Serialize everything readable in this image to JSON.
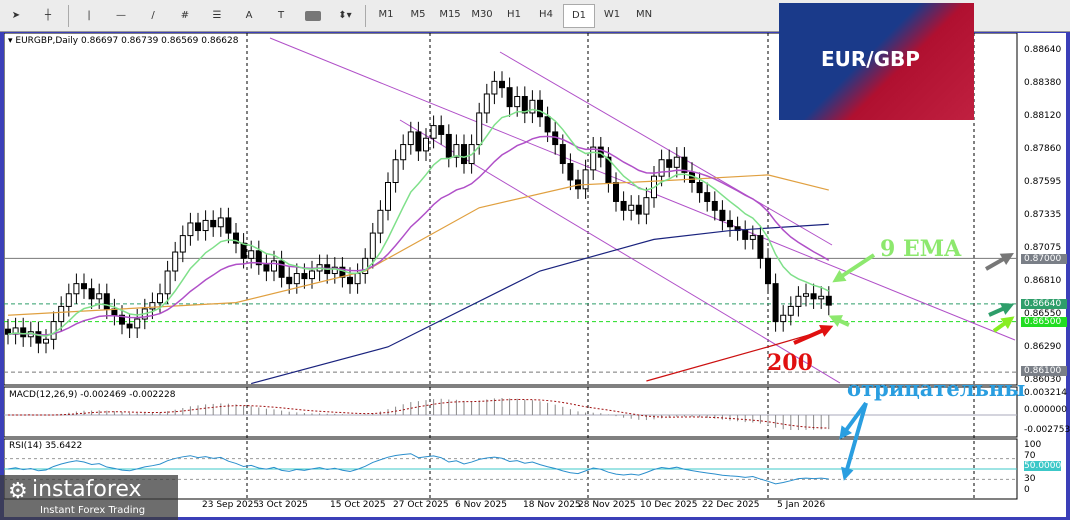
{
  "toolbar": {
    "tools": [
      "cursor",
      "crosshair",
      "vertical-line",
      "horizontal-line",
      "trendline",
      "fibonacci-expansion",
      "fibonacci-fan",
      "text",
      "text-label",
      "rectangle",
      "arrows"
    ],
    "text_tool": "A",
    "timeframes": [
      "M1",
      "M5",
      "M15",
      "M30",
      "H1",
      "H4",
      "D1",
      "W1",
      "MN"
    ],
    "active": "D1"
  },
  "header": {
    "symbol": "EURGBP,Daily",
    "ohlc": "0.86697 0.86739 0.86569 0.86628"
  },
  "banner": {
    "text": "EUR/GBP"
  },
  "annotations": {
    "ema": "9 EMA",
    "ma200": "200",
    "macd_note": "отрицательны"
  },
  "price_axis": [
    "0.88640",
    "0.88380",
    "0.88120",
    "0.87860",
    "0.87595",
    "0.87335",
    "0.87075",
    "0.86810",
    "0.86550",
    "0.86290",
    "0.86030"
  ],
  "price_tags": [
    {
      "text": "0.87000",
      "color": "#7a7f87"
    },
    {
      "text": "0.86640",
      "color": "#2e9e6a"
    },
    {
      "text": "0.86500",
      "color": "#22dd22"
    },
    {
      "text": "0.86100",
      "color": "#7a7f87"
    }
  ],
  "macd": {
    "label": "MACD(12,26,9) -0.002469 -0.002228",
    "axis": [
      "0.003214",
      "0.000000",
      "-0.002753"
    ]
  },
  "rsi": {
    "label": "RSI(14) 35.6422",
    "axis": [
      "100",
      "70",
      "50.0000",
      "30",
      "0"
    ]
  },
  "dates": [
    "23 Sep 2025",
    "3 Oct 2025",
    "15 Oct 2025",
    "27 Oct 2025",
    "6 Nov 2025",
    "18 Nov 2025",
    "28 Nov 2025",
    "10 Dec 2025",
    "22 Dec 2025",
    "5 Jan 2026"
  ],
  "logo": {
    "name": "instaforex",
    "tagline": "Instant Forex Trading"
  },
  "chart_data": {
    "type": "candlestick",
    "title": "EURGBP, Daily",
    "ylim": [
      0.8603,
      0.8864
    ],
    "closes": [
      0.864,
      0.8645,
      0.8638,
      0.8642,
      0.8633,
      0.8636,
      0.865,
      0.8662,
      0.8672,
      0.868,
      0.8676,
      0.8668,
      0.8672,
      0.866,
      0.8655,
      0.8648,
      0.8645,
      0.8652,
      0.866,
      0.8665,
      0.8672,
      0.869,
      0.8705,
      0.8718,
      0.8728,
      0.8722,
      0.873,
      0.8725,
      0.8732,
      0.872,
      0.8712,
      0.87,
      0.8706,
      0.8695,
      0.869,
      0.8698,
      0.8685,
      0.868,
      0.8688,
      0.8684,
      0.869,
      0.8695,
      0.8688,
      0.8693,
      0.8685,
      0.868,
      0.8688,
      0.87,
      0.872,
      0.8738,
      0.876,
      0.8778,
      0.879,
      0.88,
      0.8785,
      0.8795,
      0.8805,
      0.8798,
      0.878,
      0.879,
      0.8775,
      0.879,
      0.8815,
      0.883,
      0.884,
      0.8835,
      0.882,
      0.8828,
      0.8815,
      0.8825,
      0.8812,
      0.88,
      0.879,
      0.8775,
      0.8762,
      0.8755,
      0.877,
      0.8788,
      0.878,
      0.876,
      0.8745,
      0.8738,
      0.8742,
      0.8735,
      0.8748,
      0.8765,
      0.8778,
      0.8772,
      0.878,
      0.8768,
      0.876,
      0.8752,
      0.8745,
      0.8738,
      0.873,
      0.8725,
      0.8722,
      0.8715,
      0.8718,
      0.87,
      0.868,
      0.865,
      0.8655,
      0.8662,
      0.867,
      0.8672,
      0.8668,
      0.867,
      0.8663
    ],
    "ma50": [
      [
        0,
        0.8655
      ],
      [
        30,
        0.8665
      ],
      [
        47,
        0.869
      ],
      [
        62,
        0.874
      ],
      [
        75,
        0.8758
      ],
      [
        88,
        0.8762
      ],
      [
        100,
        0.8766
      ],
      [
        108,
        0.8754
      ]
    ],
    "ma100": [
      [
        32,
        0.8601
      ],
      [
        50,
        0.863
      ],
      [
        70,
        0.869
      ],
      [
        85,
        0.8715
      ],
      [
        95,
        0.8722
      ],
      [
        108,
        0.8727
      ]
    ],
    "ma200": [
      [
        84,
        0.8603
      ],
      [
        100,
        0.863
      ],
      [
        108,
        0.8644
      ]
    ],
    "levels": [
      0.87,
      0.8664,
      0.865,
      0.861
    ],
    "colors": {
      "ema9": "#7fe08a",
      "ema21": "#b050c8",
      "ma50": "#e0a040",
      "ma100": "#1a237e",
      "ma200": "#cc1010",
      "bull": "#ffffff",
      "bear": "#000000"
    }
  }
}
